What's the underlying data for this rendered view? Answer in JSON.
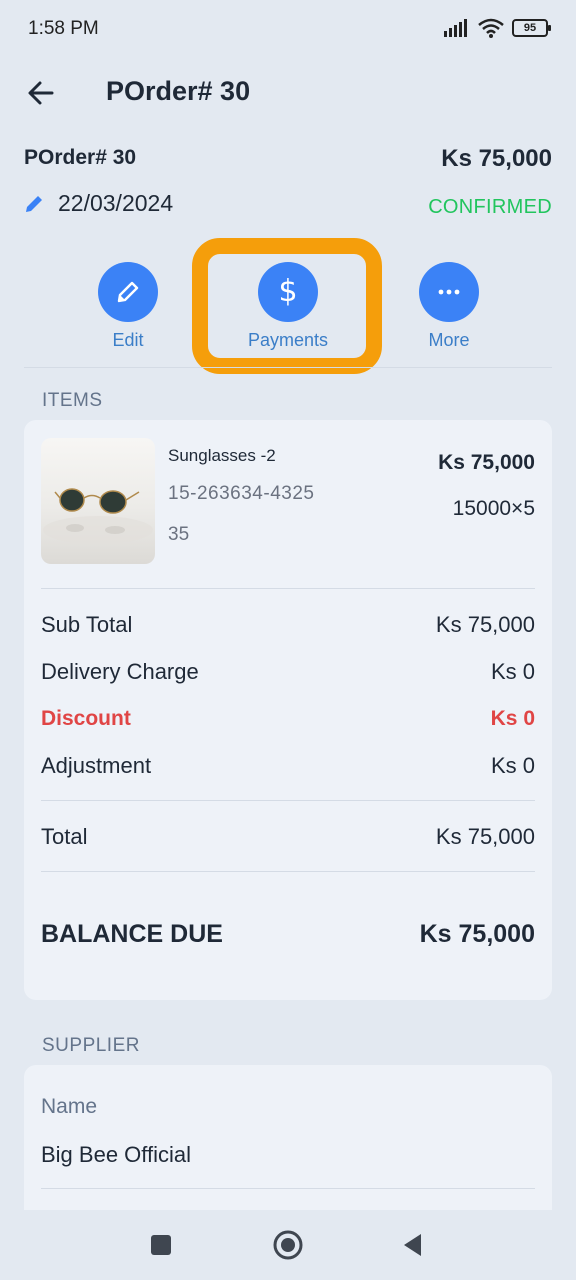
{
  "status_bar": {
    "time": "1:58 PM",
    "battery": "95"
  },
  "app_bar": {
    "title": "POrder# 30"
  },
  "header": {
    "order_id": "POrder# 30",
    "total": "Ks 75,000",
    "date": "22/03/2024",
    "status": "CONFIRMED"
  },
  "actions": [
    {
      "label": "Edit",
      "icon": "pencil-icon"
    },
    {
      "label": "Payments",
      "icon": "dollar-icon"
    },
    {
      "label": "More",
      "icon": "more-dots-icon"
    }
  ],
  "items_section": {
    "label": "ITEMS",
    "items": [
      {
        "name": "Sunglasses -2",
        "sku": "15-263634-4325",
        "number": "35",
        "amount": "Ks 75,000",
        "qty": "15000×5"
      }
    ],
    "summary": {
      "sub_total_label": "Sub Total",
      "sub_total": "Ks 75,000",
      "delivery_label": "Delivery Charge",
      "delivery": "Ks 0",
      "discount_label": "Discount",
      "discount": "Ks 0",
      "adjustment_label": "Adjustment",
      "adjustment": "Ks 0",
      "total_label": "Total",
      "total": "Ks 75,000",
      "balance_label": "BALANCE DUE",
      "balance": "Ks 75,000"
    }
  },
  "supplier_section": {
    "label": "SUPPLIER",
    "name_label": "Name",
    "name": "Big Bee Official"
  },
  "colors": {
    "accent": "#3b82f6",
    "status_confirmed": "#22c55e",
    "discount": "#e04545",
    "highlight": "#f59e0b"
  }
}
